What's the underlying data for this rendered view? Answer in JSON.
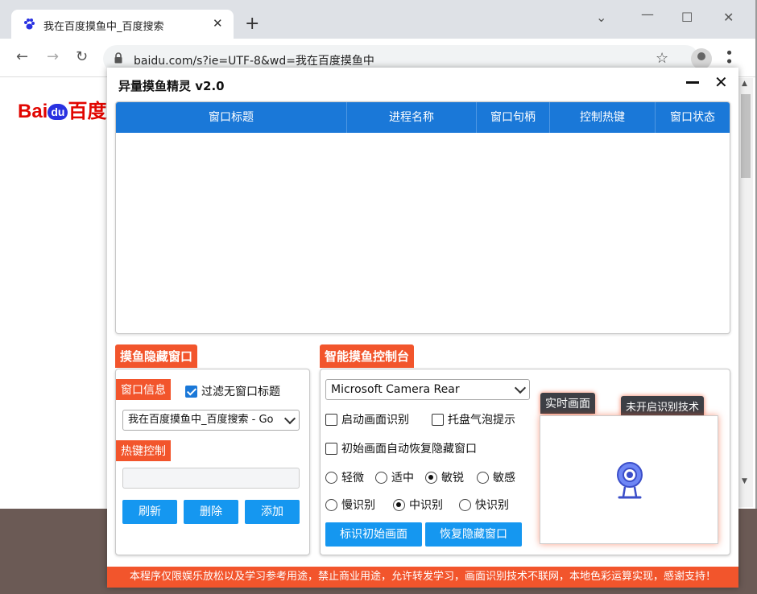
{
  "browser": {
    "tab_title": "我在百度摸鱼中_百度搜索",
    "tab_close": "✕",
    "new_tab": "+",
    "window_controls": {
      "minimize": "—",
      "restore": "☐",
      "close": "✕"
    },
    "nav": {
      "back": "←",
      "forward": "→",
      "reload": "↻"
    },
    "url": "baidu.com/s?ie=UTF-8&wd=我在百度摸鱼中",
    "bookmark_star": "☆",
    "menu": "⋮",
    "page_logo_left": "Bai",
    "page_logo_paw": "du",
    "page_logo_right": "百度"
  },
  "app": {
    "title": "异量摸鱼精灵 v2.0",
    "close_label": "✕",
    "table": {
      "columns": [
        "窗口标题",
        "进程名称",
        "窗口句柄",
        "控制热键",
        "窗口状态"
      ],
      "rows": []
    },
    "hide_panel": {
      "title": "摸鱼隐藏窗口",
      "window_info_tag": "窗口信息",
      "filter_checkbox": {
        "label": "过滤无窗口标题",
        "checked": true
      },
      "window_select_value": "我在百度摸鱼中_百度搜索 - Go",
      "hotkey_tag": "热键控制",
      "hotkey_input_value": "",
      "buttons": {
        "refresh": "刷新",
        "delete": "删除",
        "add": "添加"
      }
    },
    "smart_panel": {
      "title": "智能摸鱼控制台",
      "camera_select_value": "Microsoft Camera Rear",
      "checkboxes": {
        "start_recognition": {
          "label": "启动画面识别",
          "checked": false
        },
        "tray_bubble": {
          "label": "托盘气泡提示",
          "checked": false
        },
        "auto_restore": {
          "label": "初始画面自动恢复隐藏窗口",
          "checked": false
        }
      },
      "sensitivity": {
        "options": [
          "轻微",
          "适中",
          "敏锐",
          "敏感"
        ],
        "selected": "敏锐"
      },
      "speed": {
        "options": [
          "慢识别",
          "中识别",
          "快识别"
        ],
        "selected": "中识别"
      },
      "buttons": {
        "mark_initial": "标识初始画面",
        "restore_hidden": "恢复隐藏窗口"
      },
      "preview_tag": "实时画面",
      "status_tag": "未开启识别技术"
    },
    "footer_notice": "本程序仅限娱乐放松以及学习参考用途，禁止商业用途，允许转发学习，画面识别技术不联网，本地色彩运算实现，感谢支持！",
    "colors": {
      "accent_orange": "#f2552c",
      "header_blue": "#1a78d8",
      "button_blue": "#1597f0"
    }
  }
}
